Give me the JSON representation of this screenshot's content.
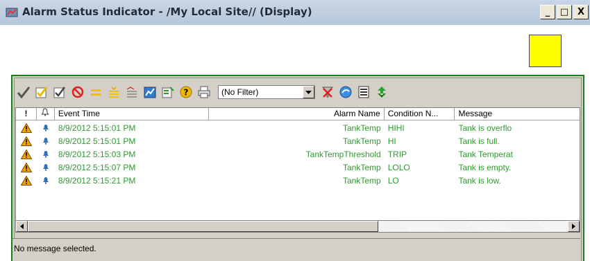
{
  "window": {
    "title": "Alarm Status Indicator - /My Local Site// (Display)",
    "controls": [
      "_",
      "□",
      "X"
    ]
  },
  "indicator": {
    "color": "#ffff00"
  },
  "toolbar": {
    "icons": [
      "check-icon",
      "ack-page-icon",
      "ack-all-icon",
      "disable-icon",
      "equal-icon",
      "sort-icon",
      "alarm-settings-icon",
      "graph-icon",
      "properties-icon",
      "help-icon",
      "print-icon",
      "filter-clear-icon",
      "refresh-globe-icon",
      "list-icon",
      "recycle-icon"
    ],
    "filter_value": "(No Filter)"
  },
  "grid": {
    "columns": {
      "priority": "!",
      "bell": "🔔",
      "event_time": "Event Time",
      "alarm_name": "Alarm Name",
      "condition": "Condition N...",
      "message": "Message"
    },
    "rows": [
      {
        "event_time": "8/9/2012 5:15:01 PM",
        "alarm_name": "TankTemp",
        "condition": "HIHI",
        "message": "Tank is overflo"
      },
      {
        "event_time": "8/9/2012 5:15:01 PM",
        "alarm_name": "TankTemp",
        "condition": "HI",
        "message": "Tank is full."
      },
      {
        "event_time": "8/9/2012 5:15:03 PM",
        "alarm_name": "TankTempThreshold",
        "condition": "TRIP",
        "message": "Tank Temperat"
      },
      {
        "event_time": "8/9/2012 5:15:07 PM",
        "alarm_name": "TankTemp",
        "condition": "LOLO",
        "message": "Tank is empty."
      },
      {
        "event_time": "8/9/2012 5:15:21 PM",
        "alarm_name": "TankTemp",
        "condition": "LO",
        "message": "Tank is low."
      }
    ],
    "row_color": "#2e9a2e"
  },
  "status": {
    "text": "No message selected."
  }
}
